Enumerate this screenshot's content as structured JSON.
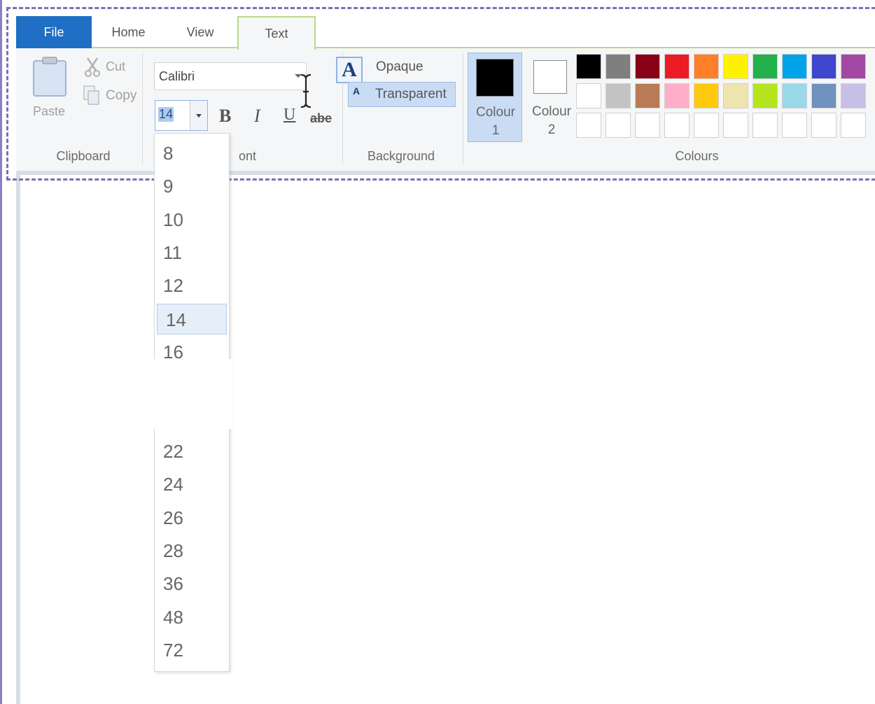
{
  "tabs": {
    "file": "File",
    "home": "Home",
    "view": "View",
    "text": "Text"
  },
  "clipboard": {
    "paste": "Paste",
    "cut": "Cut",
    "copy": "Copy",
    "group": "Clipboard"
  },
  "font": {
    "family": "Calibri",
    "size": "14",
    "group_visible": "ont",
    "bold": "B",
    "italic": "I",
    "underline": "U",
    "strikethrough": "abe"
  },
  "background": {
    "opaque": "Opaque",
    "transparent": "Transparent",
    "group": "Background",
    "icon_letter": "A"
  },
  "colours": {
    "colour1_line1": "Colour",
    "colour1_line2": "1",
    "colour2_line1": "Colour",
    "colour2_line2": "2",
    "group": "Colours",
    "colour1_value": "#000000",
    "colour2_value": "#ffffff",
    "row1": [
      "#000000",
      "#7f7f7f",
      "#880015",
      "#ed1c24",
      "#ff7f27",
      "#fff200",
      "#22b14c",
      "#00a2e8",
      "#3f48cc",
      "#a349a4"
    ],
    "row2": [
      "#ffffff",
      "#c3c3c3",
      "#b97a57",
      "#ffaec9",
      "#ffc90e",
      "#efe4b0",
      "#b5e61d",
      "#99d9ea",
      "#7092be",
      "#c8bfe7"
    ]
  },
  "size_dropdown": {
    "items_top": [
      "8",
      "9",
      "10",
      "11",
      "12",
      "14",
      "16"
    ],
    "items_bottom": [
      "22",
      "24",
      "26",
      "28",
      "36",
      "48",
      "72"
    ],
    "selected": "14"
  }
}
